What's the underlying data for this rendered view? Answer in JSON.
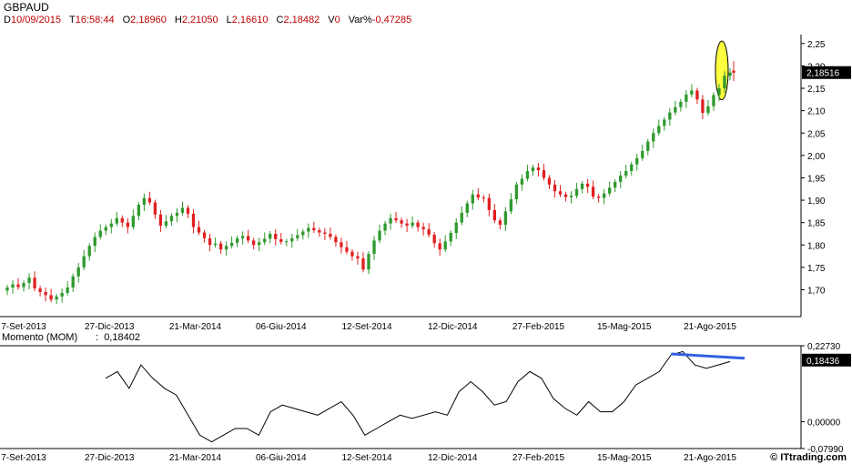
{
  "header": {
    "symbol": "GBPAUD",
    "date_label": "D",
    "date": "10/09/2015",
    "time_label": "T",
    "time": "16:58:44",
    "open_label": "O",
    "open": "2,18960",
    "high_label": "H",
    "high": "2,21050",
    "low_label": "L",
    "low": "2,16610",
    "close_label": "C",
    "close": "2,18482",
    "volume_label": "V",
    "volume": "0",
    "var_label": "Var%",
    "var": "-0,47285"
  },
  "indicator": {
    "name": "Momento (MOM)",
    "separator": ":",
    "value": "0,18402"
  },
  "footer": {
    "brand": "© ITtrading.com"
  },
  "colors": {
    "up": "#2e9a2e",
    "down": "#e02020",
    "highlight": "#ffff00",
    "trendline": "#3060e0",
    "momentum": "#000000",
    "label_box": "#000000"
  },
  "chart_data": [
    {
      "type": "candlestick",
      "title": "GBPAUD",
      "x_tick_labels": [
        "7-Set-2013",
        "27-Dic-2013",
        "21-Mar-2014",
        "06-Giu-2014",
        "12-Set-2014",
        "12-Dic-2014",
        "27-Feb-2015",
        "15-Mag-2015",
        "21-Ago-2015"
      ],
      "y_tick_labels": [
        "2,25",
        "2,20",
        "2,15",
        "2,10",
        "2,05",
        "2,00",
        "1,95",
        "1,90",
        "1,85",
        "1,80",
        "1,75",
        "1,70"
      ],
      "ylim": [
        1.64,
        2.27
      ],
      "last_price_label": "2,18516",
      "last_price": 2.18516,
      "highlight_annotation": "yellow ellipse around last candles",
      "series": [
        {
          "name": "",
          "opens": [
            1.698,
            1.705,
            1.712,
            1.706,
            1.715,
            1.727,
            1.703,
            1.695,
            1.688,
            1.678,
            1.685,
            1.693,
            1.705,
            1.73,
            1.75,
            1.775,
            1.798,
            1.818,
            1.832,
            1.84,
            1.848,
            1.86,
            1.85,
            1.84,
            1.865,
            1.89,
            1.905,
            1.895,
            1.868,
            1.843,
            1.853,
            1.865,
            1.872,
            1.883,
            1.87,
            1.84,
            1.828,
            1.815,
            1.8,
            1.803,
            1.79,
            1.798,
            1.805,
            1.815,
            1.82,
            1.81,
            1.8,
            1.806,
            1.814,
            1.825,
            1.813,
            1.807,
            1.808,
            1.815,
            1.822,
            1.83,
            1.838,
            1.833,
            1.828,
            1.825,
            1.818,
            1.806,
            1.795,
            1.785,
            1.775,
            1.77,
            1.745,
            1.78,
            1.81,
            1.832,
            1.848,
            1.86,
            1.855,
            1.848,
            1.843,
            1.85,
            1.84,
            1.835,
            1.823,
            1.804,
            1.79,
            1.808,
            1.827,
            1.85,
            1.872,
            1.893,
            1.913,
            1.906,
            1.905,
            1.878,
            1.855,
            1.845,
            1.875,
            1.902,
            1.935,
            1.948,
            1.965,
            1.973,
            1.967,
            1.95,
            1.935,
            1.92,
            1.913,
            1.907,
            1.91,
            1.925,
            1.937,
            1.93,
            1.908,
            1.905,
            1.915,
            1.928,
            1.941,
            1.955,
            1.965,
            1.98,
            1.994,
            2.01,
            2.031,
            2.05,
            2.066,
            2.08,
            2.096,
            2.108,
            2.12,
            2.136,
            2.145,
            2.125,
            2.095,
            2.11,
            2.135,
            2.15,
            2.178
          ],
          "closes": [
            1.705,
            1.712,
            1.706,
            1.715,
            1.727,
            1.703,
            1.695,
            1.688,
            1.678,
            1.685,
            1.693,
            1.705,
            1.73,
            1.75,
            1.775,
            1.798,
            1.818,
            1.832,
            1.84,
            1.848,
            1.86,
            1.85,
            1.84,
            1.865,
            1.89,
            1.905,
            1.895,
            1.868,
            1.843,
            1.853,
            1.865,
            1.872,
            1.883,
            1.87,
            1.84,
            1.828,
            1.815,
            1.8,
            1.803,
            1.79,
            1.798,
            1.805,
            1.815,
            1.82,
            1.81,
            1.8,
            1.806,
            1.814,
            1.825,
            1.813,
            1.807,
            1.808,
            1.815,
            1.822,
            1.83,
            1.838,
            1.833,
            1.828,
            1.825,
            1.818,
            1.806,
            1.795,
            1.785,
            1.775,
            1.77,
            1.745,
            1.78,
            1.81,
            1.832,
            1.848,
            1.86,
            1.855,
            1.848,
            1.843,
            1.85,
            1.84,
            1.835,
            1.823,
            1.804,
            1.79,
            1.808,
            1.827,
            1.85,
            1.872,
            1.893,
            1.913,
            1.906,
            1.905,
            1.878,
            1.855,
            1.845,
            1.875,
            1.902,
            1.935,
            1.948,
            1.965,
            1.973,
            1.967,
            1.95,
            1.935,
            1.92,
            1.913,
            1.907,
            1.91,
            1.925,
            1.937,
            1.93,
            1.908,
            1.905,
            1.915,
            1.928,
            1.941,
            1.955,
            1.965,
            1.98,
            1.994,
            2.01,
            2.031,
            2.05,
            2.066,
            2.08,
            2.096,
            2.108,
            2.12,
            2.136,
            2.145,
            2.125,
            2.095,
            2.11,
            2.135,
            2.15,
            2.178,
            2.185
          ]
        }
      ]
    },
    {
      "type": "line",
      "title": "Momento (MOM)",
      "y_tick_labels": [
        "0,22730",
        "0,00000",
        "-0,07990"
      ],
      "ylim": [
        -0.0799,
        0.2273
      ],
      "last_value_label": "0,18436",
      "trendline_annotation": "blue descending line over last peaks",
      "series": [
        {
          "name": "Momento (MOM)",
          "values": [
            0.13,
            0.15,
            0.1,
            0.17,
            0.13,
            0.1,
            0.08,
            0.02,
            -0.04,
            -0.06,
            -0.04,
            -0.02,
            -0.02,
            -0.04,
            0.03,
            0.05,
            0.04,
            0.03,
            0.02,
            0.04,
            0.06,
            0.02,
            -0.04,
            -0.02,
            0.0,
            0.02,
            0.01,
            0.02,
            0.03,
            0.02,
            0.09,
            0.12,
            0.09,
            0.05,
            0.06,
            0.12,
            0.15,
            0.13,
            0.07,
            0.04,
            0.02,
            0.06,
            0.03,
            0.03,
            0.06,
            0.11,
            0.13,
            0.15,
            0.2,
            0.21,
            0.17,
            0.16,
            0.17,
            0.18
          ]
        }
      ]
    }
  ]
}
